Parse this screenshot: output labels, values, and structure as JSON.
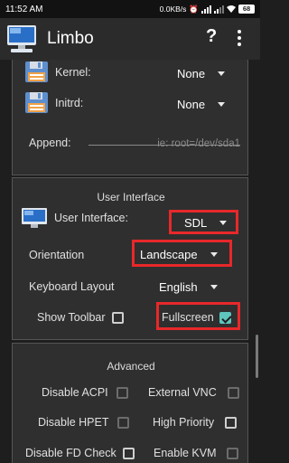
{
  "status_bar": {
    "time": "11:52 AM",
    "speed": "0.0KB/s",
    "battery": "68"
  },
  "app_bar": {
    "title": "Limbo",
    "help_label": "?"
  },
  "disk_section": {
    "kernel": {
      "label": "Kernel:",
      "value": "None"
    },
    "initrd": {
      "label": "Initrd:",
      "value": "None"
    },
    "append": {
      "label": "Append:",
      "placeholder": "ie: root=/dev/sda1"
    }
  },
  "ui_section": {
    "title": "User Interface",
    "user_interface": {
      "label": "User Interface:",
      "value": "SDL"
    },
    "orientation": {
      "label": "Orientation",
      "value": "Landscape"
    },
    "keyboard_layout": {
      "label": "Keyboard Layout",
      "value": "English"
    },
    "show_toolbar": {
      "label": "Show Toolbar",
      "checked": false
    },
    "fullscreen": {
      "label": "Fullscreen",
      "checked": true
    },
    "highlight_color": "#e8282a",
    "checkbox_accent": "#5fc4be"
  },
  "advanced_section": {
    "title": "Advanced",
    "options": [
      {
        "label": "Disable ACPI",
        "checked": false
      },
      {
        "label": "External VNC",
        "checked": false
      },
      {
        "label": "Disable HPET",
        "checked": false
      },
      {
        "label": "High Priority",
        "checked": false
      },
      {
        "label": "Disable FD Check",
        "checked": false
      },
      {
        "label": "Enable KVM",
        "checked": false
      }
    ]
  }
}
